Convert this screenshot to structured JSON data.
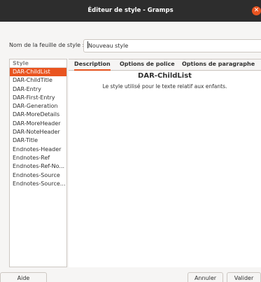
{
  "window": {
    "title": "Éditeur de style - Gramps",
    "close_glyph": "✕"
  },
  "form": {
    "name_label": "Nom de la feuille de style :",
    "name_value": "Nouveau style"
  },
  "style_list": {
    "header": "Style",
    "items": [
      "DAR-ChildList",
      "DAR-ChildTitle",
      "DAR-Entry",
      "DAR-First-Entry",
      "DAR-Generation",
      "DAR-MoreDetails",
      "DAR-MoreHeader",
      "DAR-NoteHeader",
      "DAR-Title",
      "Endnotes-Header",
      "Endnotes-Ref",
      "Endnotes-Ref-No...",
      "Endnotes-Source",
      "Endnotes-Source-..."
    ],
    "selected_index": 0
  },
  "tabs": [
    {
      "label": "Description",
      "active": true
    },
    {
      "label": "Options de police",
      "active": false
    },
    {
      "label": "Options de paragraphe",
      "active": false
    }
  ],
  "description": {
    "style_name": "DAR-ChildList",
    "text": "Le style utilisé pour le texte relatif aux enfants."
  },
  "buttons": {
    "help": "Aide",
    "cancel": "Annuler",
    "ok": "Valider"
  },
  "colors": {
    "accent": "#e95420",
    "titlebar": "#2d2d2d"
  }
}
